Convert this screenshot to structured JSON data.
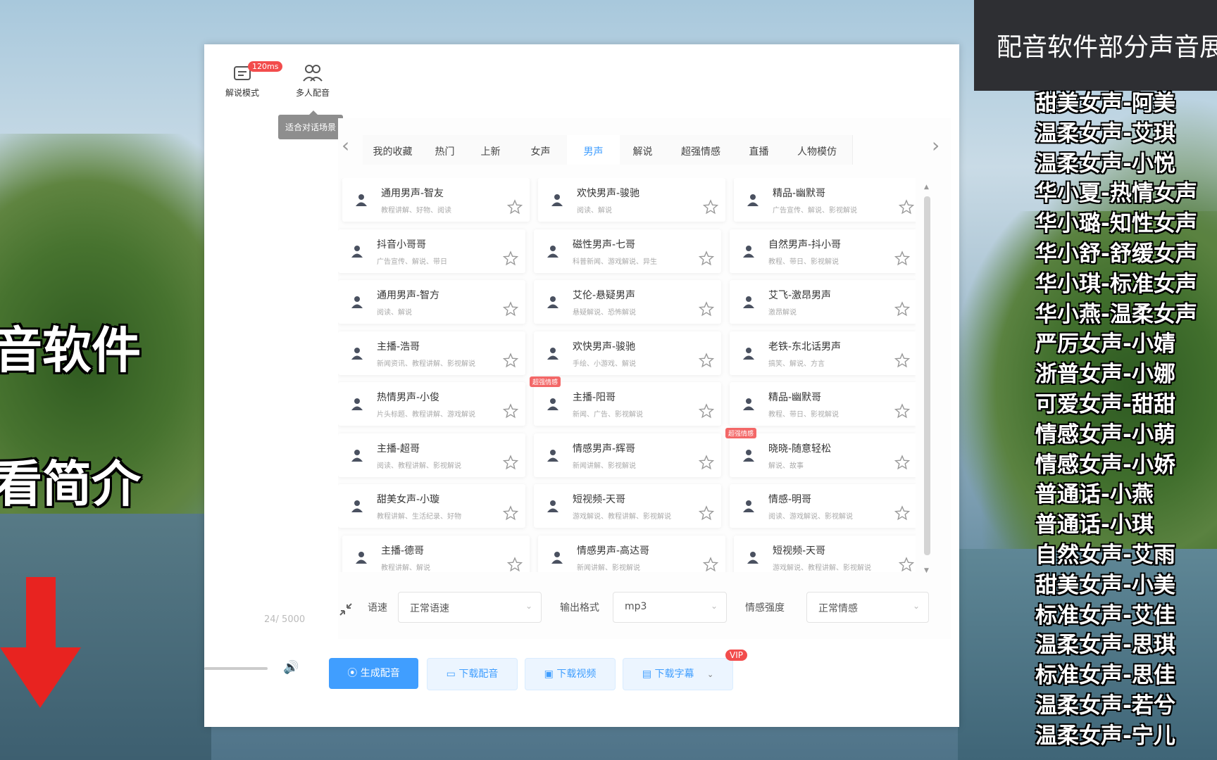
{
  "overlay": {
    "top_right_title": "配音软件部分声音展",
    "left_captions": [
      "音软件",
      "看简介"
    ],
    "voice_list": [
      "甜美女声-阿美",
      "温柔女声-艾琪",
      "温柔女声-小悦",
      "华小夏-热情女声",
      "华小璐-知性女声",
      "华小舒-舒缓女声",
      "华小琪-标准女声",
      "华小燕-温柔女声",
      "严厉女声-小婧",
      "浙普女声-小娜",
      "可爱女声-甜甜",
      "情感女声-小萌",
      "情感女声-小娇",
      "普通话-小燕",
      "普通话-小琪",
      "自然女声-艾雨",
      "甜美女声-小美",
      "标准女声-艾佳",
      "温柔女声-思琪",
      "标准女声-思佳",
      "温柔女声-若兮",
      "温柔女声-宁儿"
    ]
  },
  "modes": {
    "narration": {
      "label": "解说模式",
      "badge": "120ms"
    },
    "multi": {
      "label": "多人配音",
      "tooltip": "适合对话场景"
    }
  },
  "tabs": [
    "我的收藏",
    "热门",
    "上新",
    "女声",
    "男声",
    "解说",
    "超强情感",
    "直播",
    "人物模仿"
  ],
  "active_tab": "男声",
  "voices": [
    [
      {
        "name": "通用男声-智友",
        "tags": "教程讲解、好物、阅读"
      },
      {
        "name": "欢快男声-骏驰",
        "tags": "阅读、解说"
      },
      {
        "name": "精品-幽默哥",
        "tags": "广告宣传、解说、影视解说"
      }
    ],
    [
      {
        "name": "抖音小哥哥",
        "tags": "广告宣传、解说、带日"
      },
      {
        "name": "磁性男声-七哥",
        "tags": "科普新闻、游戏解说、异生"
      },
      {
        "name": "自然男声-抖小哥",
        "tags": "教程、带日、影视解说"
      }
    ],
    [
      {
        "name": "通用男声-智方",
        "tags": "阅读、解说"
      },
      {
        "name": "艾伦-悬疑男声",
        "tags": "悬疑解说、恐怖解说"
      },
      {
        "name": "艾飞-激昂男声",
        "tags": "激昂解说"
      }
    ],
    [
      {
        "name": "主播-浩哥",
        "tags": "新闻资讯、教程讲解、影视解说"
      },
      {
        "name": "欢快男声-骏驰",
        "tags": "手绘、小游戏、解说"
      },
      {
        "name": "老铁-东北话男声",
        "tags": "搞笑、解说、方言"
      }
    ],
    [
      {
        "name": "热情男声-小俊",
        "tags": "片头标题、教程讲解、游戏解说"
      },
      {
        "name": "主播-阳哥",
        "tags": "新闻、广告、影视解说",
        "promo": "超强情感"
      },
      {
        "name": "精品-幽默哥",
        "tags": "教程、带日、影视解说"
      }
    ],
    [
      {
        "name": "主播-超哥",
        "tags": "阅读、教程讲解、影视解说"
      },
      {
        "name": "情感男声-辉哥",
        "tags": "新闻讲解、影视解说"
      },
      {
        "name": "晓晓-随意轻松",
        "tags": "解说、故事",
        "promo": "超强情感"
      }
    ],
    [
      {
        "name": "甜美女声-小璇",
        "tags": "教程讲解、生活纪录、好物"
      },
      {
        "name": "短视频-天哥",
        "tags": "游戏解说、教程讲解、影视解说"
      },
      {
        "name": "情感-明哥",
        "tags": "阅读、游戏解说、影视解说"
      }
    ],
    [
      {
        "name": "主播-德哥",
        "tags": "教程讲解、解说"
      },
      {
        "name": "情感男声-高达哥",
        "tags": "新闻讲解、影视解说"
      },
      {
        "name": "短视频-天哥",
        "tags": "游戏解说、教程讲解、影视解说"
      }
    ]
  ],
  "options": {
    "speed_label": "语速",
    "speed_value": "正常语速",
    "format_label": "输出格式",
    "format_value": "mp3",
    "emotion_label": "情感强度",
    "emotion_value": "正常情感"
  },
  "counter": "24/ 5000",
  "buttons": {
    "generate": "生成配音",
    "download_audio": "下载配音",
    "download_video": "下载视频",
    "download_subtitle": "下载字幕",
    "vip": "VIP"
  },
  "colors": {
    "accent": "#409eff",
    "badge": "#f24c4c",
    "arrow": "#e82320"
  }
}
